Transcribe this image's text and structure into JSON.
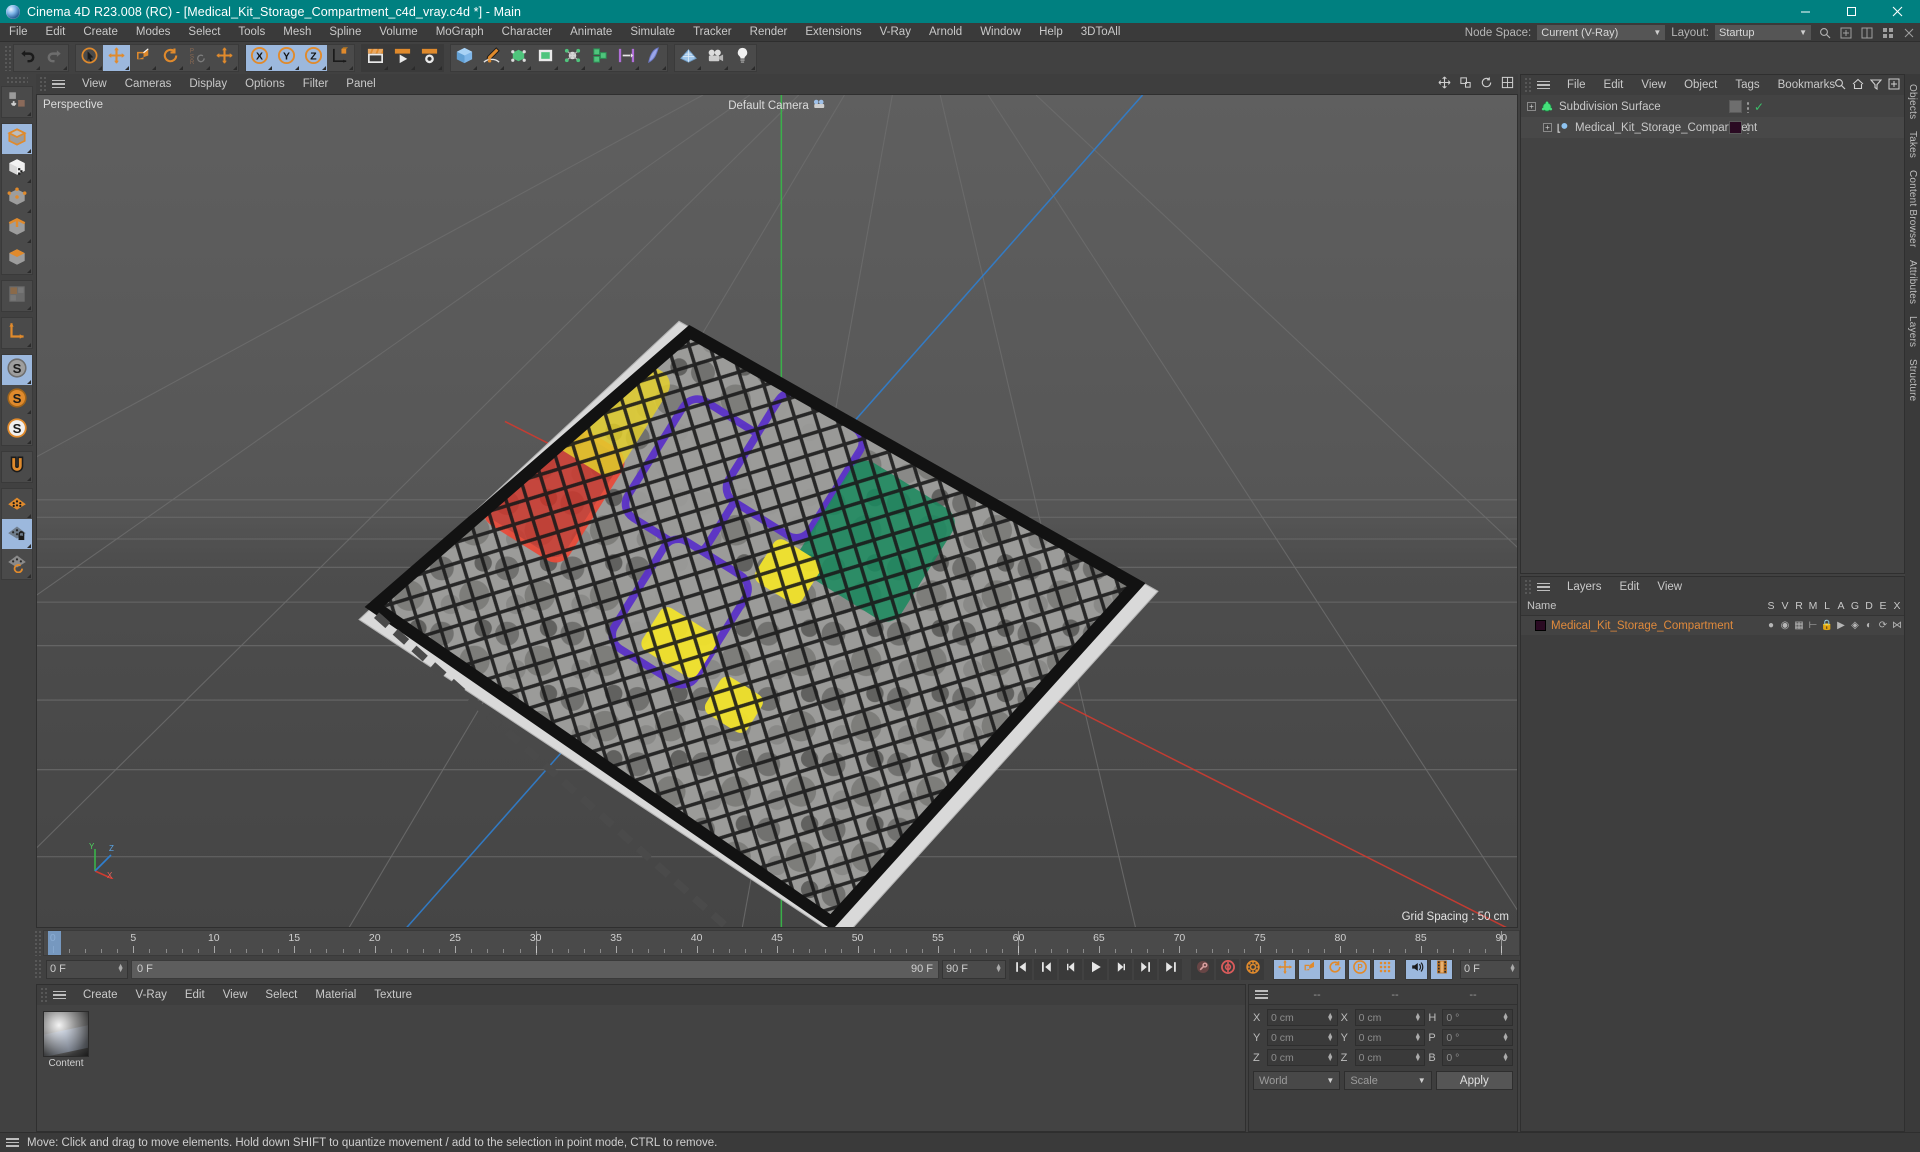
{
  "titlebar": {
    "app_icon": "c4d-logo-icon",
    "title": "Cinema 4D R23.008 (RC) - [Medical_Kit_Storage_Compartment_c4d_vray.c4d *] - Main",
    "minimize": "minimize-icon",
    "maximize": "maximize-icon",
    "close": "close-icon"
  },
  "menubar": {
    "items": [
      "File",
      "Edit",
      "Create",
      "Modes",
      "Select",
      "Tools",
      "Mesh",
      "Spline",
      "Volume",
      "MoGraph",
      "Character",
      "Animate",
      "Simulate",
      "Tracker",
      "Render",
      "Extensions",
      "V-Ray",
      "Arnold",
      "Window",
      "Help",
      "3DToAll"
    ],
    "node_space_label": "Node Space:",
    "node_space_value": "Current (V-Ray)",
    "layout_label": "Layout:",
    "layout_value": "Startup",
    "search_icon": "search-icon"
  },
  "toolbar": {
    "groups": [
      {
        "name": "history",
        "buttons": [
          {
            "name": "undo-button",
            "icon": "undo-icon",
            "state": "normal"
          },
          {
            "name": "redo-button",
            "icon": "redo-icon",
            "state": "disabled"
          }
        ]
      },
      {
        "name": "transform",
        "buttons": [
          {
            "name": "select-tool-button",
            "icon": "cursor-circle-icon",
            "state": "normal"
          },
          {
            "name": "move-tool-button",
            "icon": "move-arrows-icon",
            "state": "selected"
          },
          {
            "name": "scale-tool-button",
            "icon": "scale-box-icon",
            "state": "normal"
          },
          {
            "name": "rotate-tool-button",
            "icon": "rotate-arrows-icon",
            "state": "normal"
          },
          {
            "name": "psr-tool-button",
            "icon": "psr-icon",
            "state": "normal"
          },
          {
            "name": "move-duplicate-button",
            "icon": "move-arrows-icon",
            "state": "normal"
          }
        ]
      },
      {
        "name": "axis-locks",
        "buttons": [
          {
            "name": "lock-x-button",
            "icon": "axis-x-icon",
            "state": "selected"
          },
          {
            "name": "lock-y-button",
            "icon": "axis-y-icon",
            "state": "selected"
          },
          {
            "name": "lock-z-button",
            "icon": "axis-z-icon",
            "state": "selected"
          },
          {
            "name": "world-object-axis-button",
            "icon": "world-axis-icon",
            "state": "normal"
          }
        ]
      },
      {
        "name": "render",
        "buttons": [
          {
            "name": "render-view-button",
            "icon": "render-view-icon",
            "state": "dark"
          },
          {
            "name": "render-to-picture-viewer-button",
            "icon": "render-picture-icon",
            "state": "dark"
          },
          {
            "name": "render-settings-button",
            "icon": "render-settings-icon",
            "state": "dark"
          }
        ]
      },
      {
        "name": "objects",
        "buttons": [
          {
            "name": "add-cube-button",
            "icon": "cube-primitive-icon",
            "state": "normal"
          },
          {
            "name": "add-spline-button",
            "icon": "pen-spline-icon",
            "state": "normal"
          },
          {
            "name": "generators-button",
            "icon": "generator-icon",
            "state": "normal"
          },
          {
            "name": "nurbs-button",
            "icon": "nurbs-cube-icon",
            "state": "normal"
          },
          {
            "name": "deformers-button",
            "icon": "deformer-icon",
            "state": "normal"
          },
          {
            "name": "mograph-button",
            "icon": "mograph-cloner-icon",
            "state": "normal"
          },
          {
            "name": "snap-toggle-button",
            "icon": "snap-bars-icon",
            "state": "normal"
          },
          {
            "name": "field-object-button",
            "icon": "field-wave-icon",
            "state": "normal"
          }
        ]
      },
      {
        "name": "scene",
        "buttons": [
          {
            "name": "add-floor-button",
            "icon": "floor-grid-icon",
            "state": "normal"
          },
          {
            "name": "add-camera-button",
            "icon": "camera-icon",
            "state": "normal"
          },
          {
            "name": "add-light-button",
            "icon": "light-bulb-icon",
            "state": "normal"
          }
        ]
      }
    ]
  },
  "leftbar": {
    "groups": [
      {
        "name": "convert",
        "buttons": [
          {
            "name": "make-editable-button",
            "icon": "make-editable-icon"
          }
        ]
      },
      {
        "name": "modes",
        "buttons": [
          {
            "name": "model-mode-button",
            "icon": "model-cube-icon",
            "state": "selected"
          },
          {
            "name": "texture-mode-button",
            "icon": "texture-cube-icon"
          },
          {
            "name": "points-mode-button",
            "icon": "points-cube-icon"
          },
          {
            "name": "edges-mode-button",
            "icon": "edges-cube-icon"
          },
          {
            "name": "polygons-mode-button",
            "icon": "polygons-cube-icon"
          }
        ]
      },
      {
        "name": "uv",
        "buttons": [
          {
            "name": "uv-mode-button",
            "icon": "uv-squares-icon"
          }
        ]
      },
      {
        "name": "axis",
        "buttons": [
          {
            "name": "enable-axis-button",
            "icon": "axis-l-icon"
          }
        ]
      },
      {
        "name": "selection",
        "buttons": [
          {
            "name": "use-selection-button",
            "icon": "s-gray-icon",
            "state": "selected"
          },
          {
            "name": "use-model-button",
            "icon": "s-orange-icon"
          },
          {
            "name": "use-object-button",
            "icon": "s-white-icon"
          }
        ]
      },
      {
        "name": "snap-group",
        "buttons": [
          {
            "name": "snap-magnet-button",
            "icon": "magnet-icon"
          }
        ]
      },
      {
        "name": "grid-group",
        "buttons": [
          {
            "name": "workplane-button",
            "icon": "orange-grid-icon"
          },
          {
            "name": "lock-workplane-button",
            "icon": "lock-grid-icon",
            "state": "selected"
          },
          {
            "name": "rotate-workplane-button",
            "icon": "rotate-grid-icon"
          }
        ]
      }
    ]
  },
  "viewport": {
    "menu": [
      "View",
      "Cameras",
      "Display",
      "Options",
      "Filter",
      "Panel"
    ],
    "view_label": "Perspective",
    "camera_label": "Default Camera",
    "camera_icon": "camera-small-icon",
    "grid_spacing": "Grid Spacing : 50 cm",
    "axis_labels": {
      "x": "X",
      "y": "Y",
      "z": "Z"
    },
    "hud_icons": [
      "move-hud-icon",
      "scale-hud-icon",
      "rotate-hud-icon",
      "maximize-view-icon"
    ]
  },
  "timeline": {
    "ticks": [
      0,
      5,
      10,
      15,
      20,
      25,
      30,
      35,
      40,
      45,
      50,
      55,
      60,
      65,
      70,
      75,
      80,
      85,
      90
    ],
    "range_start": 0,
    "range_end": 90,
    "current_frame": "0 F",
    "frame_field_left": "0 F",
    "range_bar_left": "0 F",
    "range_bar_right": "90 F",
    "end_frame_field": "90 F",
    "frame_field_right": "0 F",
    "transport": [
      {
        "name": "go-to-start-button",
        "icon": "skip-start-icon",
        "state": "dark"
      },
      {
        "name": "go-to-previous-key-button",
        "icon": "prev-key-icon",
        "state": "dark"
      },
      {
        "name": "step-back-button",
        "icon": "step-back-icon",
        "state": "dark"
      },
      {
        "name": "play-button",
        "icon": "play-icon",
        "state": "dark"
      },
      {
        "name": "step-forward-button",
        "icon": "step-forward-icon",
        "state": "dark"
      },
      {
        "name": "go-to-next-key-button",
        "icon": "next-key-icon",
        "state": "dark"
      },
      {
        "name": "go-to-end-button",
        "icon": "skip-end-icon",
        "state": "dark"
      },
      {
        "name": "record-active-objects-button",
        "icon": "key-record-icon",
        "state": "dark"
      },
      {
        "name": "autokeying-button",
        "icon": "autokey-circle-icon",
        "state": "dark"
      },
      {
        "name": "keyframe-settings-button",
        "icon": "gear-key-icon",
        "state": "dark"
      },
      {
        "name": "position-key-button",
        "icon": "move-key-icon",
        "state": "selected"
      },
      {
        "name": "scale-key-button",
        "icon": "scale-key-icon",
        "state": "selected"
      },
      {
        "name": "rotation-key-button",
        "icon": "rotate-key-icon",
        "state": "selected"
      },
      {
        "name": "param-key-button",
        "icon": "p-circle-icon",
        "state": "selected"
      },
      {
        "name": "point-level-anim-button",
        "icon": "dots-grid-icon",
        "state": "selected"
      },
      {
        "name": "sound-button",
        "icon": "sound-icon",
        "state": "selected"
      },
      {
        "name": "film-strip-button",
        "icon": "film-strip-icon",
        "state": "selected"
      }
    ]
  },
  "material_manager": {
    "menu": [
      "Create",
      "V-Ray",
      "Edit",
      "View",
      "Select",
      "Material",
      "Texture"
    ],
    "materials": [
      {
        "name": "Content",
        "thumb": "sphere-preview"
      }
    ]
  },
  "coordinates": {
    "headers": [
      "--",
      "--",
      "--"
    ],
    "rows": [
      {
        "label1": "X",
        "value1": "0 cm",
        "label2": "X",
        "value2": "0 cm",
        "label3": "H",
        "value3": "0 °"
      },
      {
        "label1": "Y",
        "value1": "0 cm",
        "label2": "Y",
        "value2": "0 cm",
        "label3": "P",
        "value3": "0 °"
      },
      {
        "label1": "Z",
        "value1": "0 cm",
        "label2": "Z",
        "value2": "0 cm",
        "label3": "B",
        "value3": "0 °"
      }
    ],
    "space_select": "World",
    "mode_select": "Scale",
    "apply_label": "Apply"
  },
  "object_manager": {
    "menu": [
      "File",
      "Edit",
      "View",
      "Object",
      "Tags",
      "Bookmarks"
    ],
    "right_icons": [
      "search-icon",
      "home-icon",
      "filter-icon",
      "add-panel-icon"
    ],
    "items": [
      {
        "name": "Subdivision Surface",
        "icon": "subdivision-surface-icon",
        "depth": 0,
        "tag": "blank-tag",
        "check": true
      },
      {
        "name": "Medical_Kit_Storage_Compartment",
        "icon": "polygon-object-icon",
        "depth": 1,
        "tag": "material-tag-dark",
        "check": false
      }
    ]
  },
  "layer_manager": {
    "menu": [
      "Layers",
      "Edit",
      "View"
    ],
    "name_header": "Name",
    "columns": [
      "S",
      "V",
      "R",
      "M",
      "L",
      "A",
      "G",
      "D",
      "E",
      "X"
    ],
    "rows": [
      {
        "name": "Medical_Kit_Storage_Compartment",
        "color": "#2a0a22"
      }
    ]
  },
  "right_tabs": [
    "Objects",
    "Takes",
    "Content Browser",
    "Attributes",
    "Layers",
    "Structure"
  ],
  "statusbar": {
    "menu_icon": "hamburger-icon",
    "message": "Move: Click and drag to move elements. Hold down SHIFT to quantize movement / add to the selection in point mode, CTRL to remove."
  },
  "colors": {
    "teal_title": "#008080",
    "panel_bg": "#414141",
    "selected_blue": "#9cb8dd",
    "orange_accent": "#e08a3c",
    "axis_x": "#c0392b",
    "axis_y": "#27ae60",
    "axis_z": "#2980b9"
  }
}
